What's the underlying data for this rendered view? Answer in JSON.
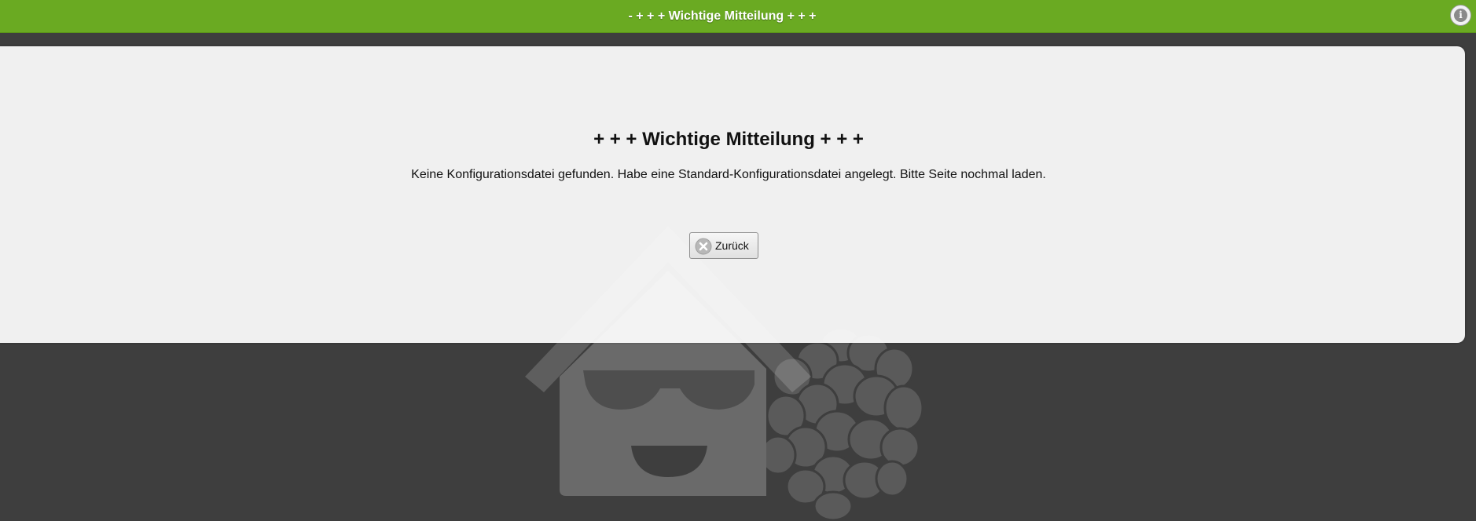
{
  "header": {
    "title": "- + + + Wichtige Mitteilung + + +",
    "info_icon": "info-icon",
    "bar_color": "#6aaa22"
  },
  "notice": {
    "title": "+ + + Wichtige Mitteilung + + +",
    "message": "Keine Konfigurationsdatei gefunden. Habe eine Standard-Konfigurationsdatei angelegt. Bitte Seite nochmal laden.",
    "back_button": {
      "label": "Zurück",
      "icon": "close-circle-icon"
    }
  },
  "background": {
    "logo": "house-with-sunglasses-and-raspberry-logo",
    "color": "#3e3e3e"
  }
}
